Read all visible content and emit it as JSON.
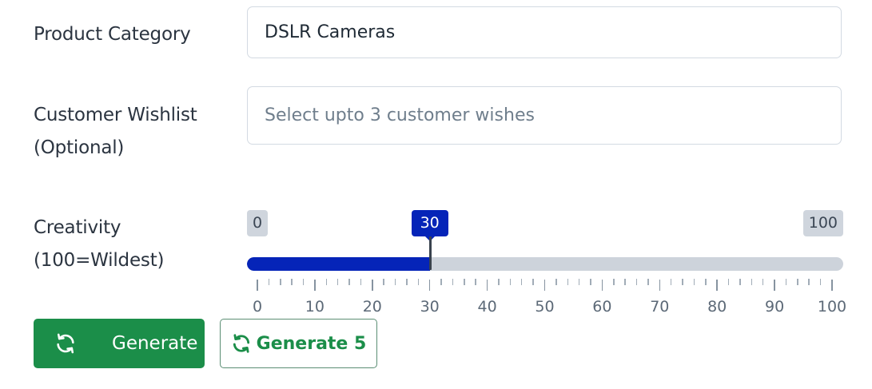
{
  "form": {
    "product_category": {
      "label": "Product Category",
      "value": "DSLR Cameras"
    },
    "customer_wishlist": {
      "label_line1": "Customer Wishlist",
      "label_line2": "(Optional)",
      "placeholder": "Select upto 3 customer wishes"
    },
    "creativity": {
      "label_line1": "Creativity",
      "label_line2": "(100=Wildest)",
      "min": 0,
      "max": 100,
      "value": 30,
      "min_label": "0",
      "max_label": "100",
      "value_label": "30",
      "tick_labels": [
        "0",
        "10",
        "20",
        "30",
        "40",
        "50",
        "60",
        "70",
        "80",
        "90",
        "100"
      ]
    }
  },
  "buttons": {
    "generate_label": "Generate",
    "generate_5_label": "Generate 5",
    "icon": "refresh-icon"
  },
  "colors": {
    "primary_green": "#1b8e49",
    "slider_blue": "#0524b8",
    "track_gray": "#cdd3db"
  }
}
